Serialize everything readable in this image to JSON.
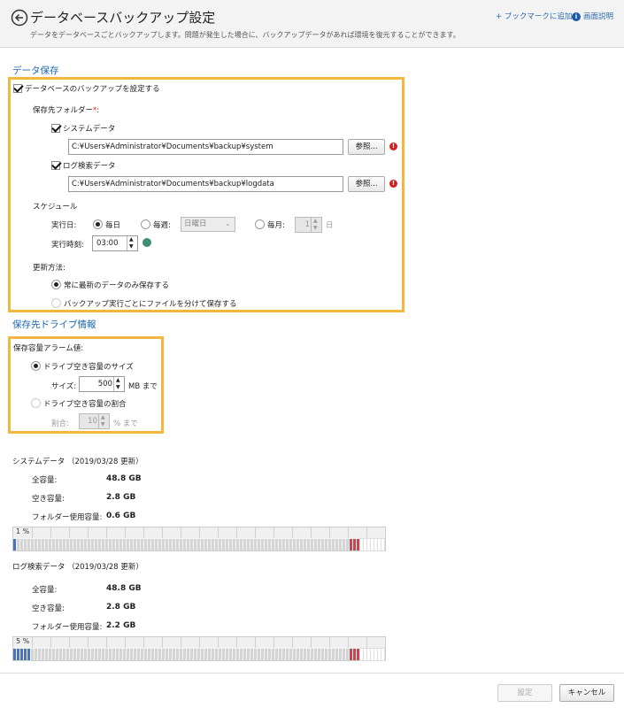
{
  "header": {
    "title": "データベースバックアップ設定",
    "description": "データをデータベースごとバックアップします。問題が発生した場合に、バックアップデータがあれば環境を復元することができます。",
    "bookmark_link": "+ ブックマークに追加",
    "help_link": "画面説明"
  },
  "data_save": {
    "section_title": "データ保存",
    "enable_backup_label": "データベースのバックアップを設定する",
    "dest_folder_label": "保存先フォルダー",
    "required_mark": "*",
    "colon": ":",
    "system_data_label": "システムデータ",
    "system_path": "C:¥Users¥Administrator¥Documents¥backup¥system",
    "browse_label": "参照...",
    "log_data_label": "ログ検索データ",
    "log_path": "C:¥Users¥Administrator¥Documents¥backup¥logdata",
    "schedule_label": "スケジュール",
    "run_day_label": "実行日:",
    "daily_label": "毎日",
    "weekly_label": "毎週:",
    "weekday_value": "日曜日",
    "monthly_label": "毎月:",
    "month_day_value": "1",
    "day_suffix": "日",
    "run_time_label": "実行時刻:",
    "run_time_value": "03:00",
    "update_method_label": "更新方法:",
    "keep_latest_label": "常に最新のデータのみ保存する",
    "separate_files_label": "バックアップ実行ごとにファイルを分けて保存する"
  },
  "drive_info": {
    "section_title": "保存先ドライブ情報",
    "alarm_label": "保存容量アラーム値:",
    "by_size_label": "ドライブ空き容量のサイズ",
    "size_label": "サイズ:",
    "size_value": "500",
    "size_unit": "MB まで",
    "by_ratio_label": "ドライブ空き容量の割合",
    "ratio_label": "割合:",
    "ratio_value": "10",
    "ratio_unit": "% まで"
  },
  "system_usage": {
    "title": "システムデータ （2019/03/28 更新）",
    "total_label": "全容量:",
    "total_value": "48.8 GB",
    "free_label": "空き容量:",
    "free_value": "2.8 GB",
    "used_label": "フォルダー使用容量:",
    "used_value": "0.6 GB",
    "bar_pct": "1 %",
    "bar_fill": 0.01
  },
  "log_usage": {
    "title": "ログ検索データ （2019/03/28 更新）",
    "total_label": "全容量:",
    "total_value": "48.8 GB",
    "free_label": "空き容量:",
    "free_value": "2.8 GB",
    "used_label": "フォルダー使用容量:",
    "used_value": "2.2 GB",
    "bar_pct": "5 %",
    "bar_fill": 0.05
  },
  "footer": {
    "save_label": "設定",
    "cancel_label": "キャンセル"
  },
  "colors": {
    "accent": "#1a64b0",
    "highlight": "#f4b63f",
    "used_fill": "#4a72c4",
    "alarm_fill": "#c9464f",
    "error": "#d61f1f"
  }
}
